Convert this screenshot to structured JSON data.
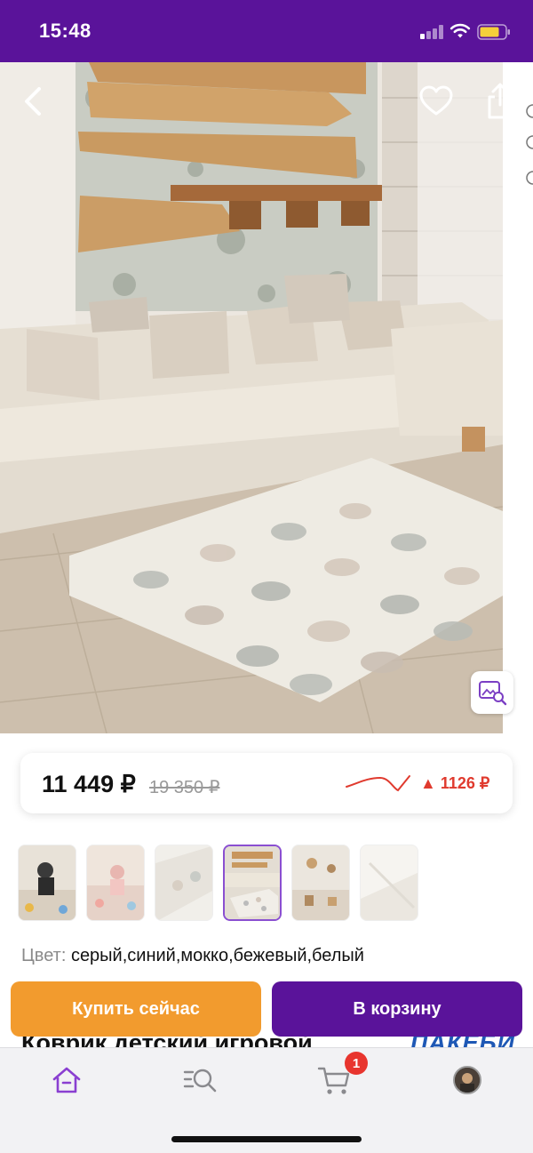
{
  "status_bar": {
    "time": "15:48",
    "background": "#5a139a"
  },
  "hero": {
    "actions": {
      "back_icon": "chevron-left-icon",
      "favorite_icon": "heart-icon",
      "share_icon": "share-icon",
      "visual_search_icon": "image-search-icon"
    }
  },
  "price": {
    "current": "11 449 ₽",
    "old": "19 350 ₽",
    "delta": "▲ 1126 ₽",
    "delta_color": "#e03a2e"
  },
  "gallery": {
    "thumbnail_count": 6,
    "selected_index": 3
  },
  "product": {
    "color_label": "Цвет:",
    "color_value": "серый,синий,мокко,бежевый,белый",
    "title_partial": "Коврик детский игровой",
    "brand_partial": "ПАКЕБИ"
  },
  "actions": {
    "buy_now": "Купить сейчас",
    "add_to_cart": "В корзину",
    "buy_color": "#f29b2e",
    "cart_color": "#5a139a"
  },
  "tab_bar": {
    "items": [
      {
        "id": "home",
        "icon": "home-icon",
        "active": true
      },
      {
        "id": "catalog",
        "icon": "catalog-search-icon",
        "active": false
      },
      {
        "id": "cart",
        "icon": "cart-icon",
        "active": false
      },
      {
        "id": "profile",
        "icon": "avatar",
        "active": false
      }
    ],
    "cart_badge": "1",
    "accent": "#8a3fd1"
  }
}
